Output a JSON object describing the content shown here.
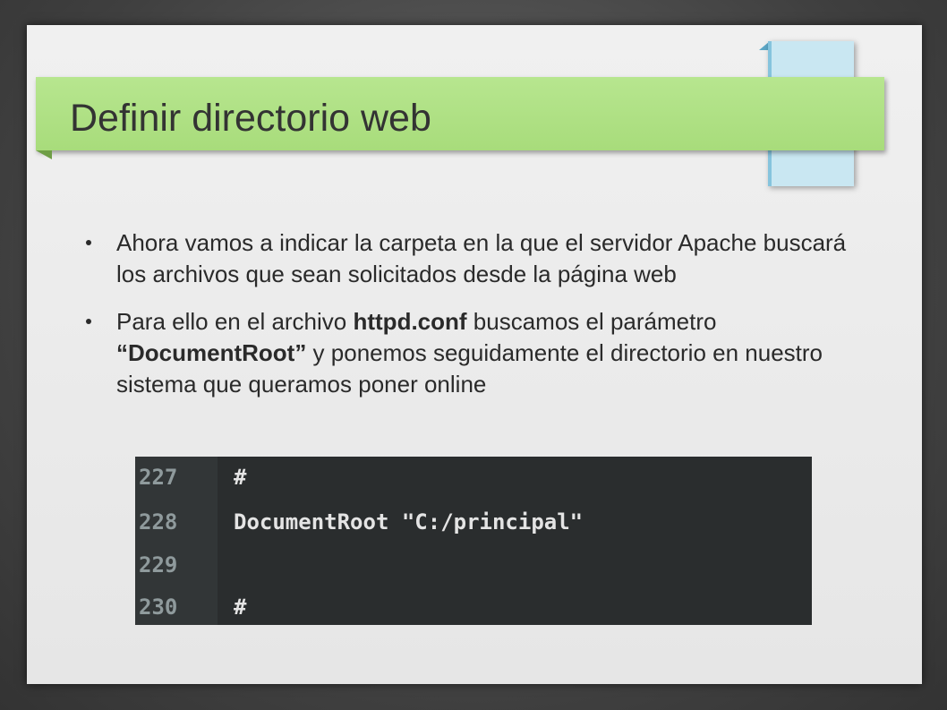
{
  "slide": {
    "title": "Definir directorio web",
    "bullets": [
      {
        "parts": [
          {
            "text": "Ahora vamos a indicar la carpeta en la que el servidor Apache buscará los archivos que sean solicitados desde la página web",
            "bold": false
          }
        ]
      },
      {
        "parts": [
          {
            "text": "Para ello en el archivo ",
            "bold": false
          },
          {
            "text": "httpd.conf",
            "bold": true
          },
          {
            "text": " buscamos el parámetro ",
            "bold": false
          },
          {
            "text": "“DocumentRoot”",
            "bold": true
          },
          {
            "text": " y ponemos seguidamente el directorio en nuestro sistema que queramos poner online",
            "bold": false
          }
        ]
      }
    ]
  },
  "code": {
    "lines": [
      {
        "num": "227",
        "text": "#"
      },
      {
        "num": "228",
        "text": "DocumentRoot \"C:/principal\""
      },
      {
        "num": "229",
        "text": ""
      },
      {
        "num": "230",
        "text": "#"
      }
    ]
  },
  "colors": {
    "title_bar": "#a8dc7b",
    "accent_card": "#c9e7f2",
    "code_background": "#2a2d2e"
  }
}
